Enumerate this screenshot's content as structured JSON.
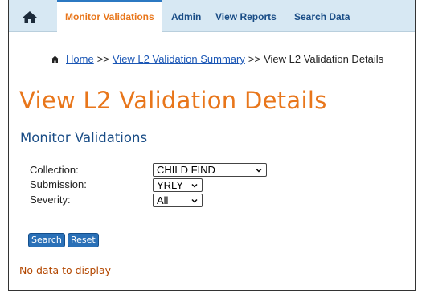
{
  "nav": {
    "items": [
      {
        "label": "Monitor Validations",
        "active": true
      },
      {
        "label": "Admin",
        "active": false
      },
      {
        "label": "View Reports",
        "active": false
      },
      {
        "label": "Search Data",
        "active": false
      }
    ],
    "home_icon": "home-icon"
  },
  "breadcrumb": {
    "home_icon": "home-icon",
    "home": "Home",
    "separator": ">>",
    "summary": "View L2 Validation Summary",
    "current": "View L2 Validation Details"
  },
  "page": {
    "title": "View L2 Validation Details",
    "section_title": "Monitor Validations"
  },
  "form": {
    "collection": {
      "label": "Collection:",
      "value": "CHILD FIND"
    },
    "submission": {
      "label": "Submission:",
      "value": "YRLY"
    },
    "severity": {
      "label": "Severity:",
      "value": "All"
    },
    "search_label": "Search",
    "reset_label": "Reset"
  },
  "status": {
    "no_data": "No data to display"
  },
  "colors": {
    "accent_orange": "#e8761b",
    "nav_blue": "#1a4d86",
    "nav_bg": "#d7e8f3",
    "button_blue": "#2a70b7",
    "link_blue": "#1a56b5",
    "warning_text": "#b34700"
  }
}
